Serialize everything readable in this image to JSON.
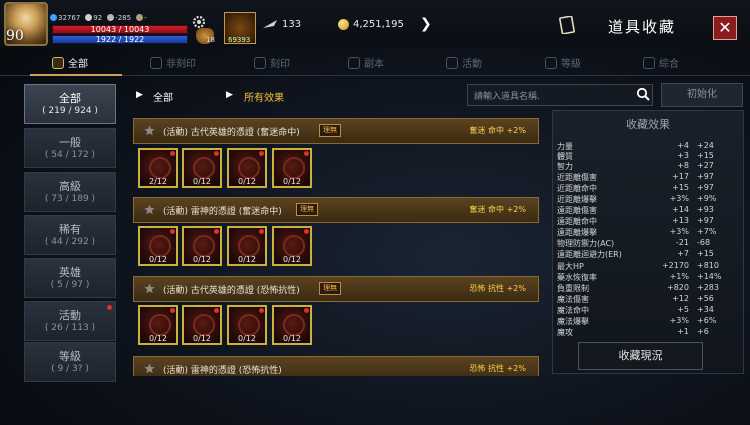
{
  "player": {
    "level": "90",
    "currency1": "32767",
    "stat2": "92",
    "stat3": "-285",
    "stat4": "-",
    "hp": "10043 / 10043",
    "mp": "1922 / 1922"
  },
  "topbar": {
    "pouch_count": "18",
    "quick_item_count": "69393",
    "wing_value": "133",
    "gold_value": "4,251,195",
    "title": "道具收藏"
  },
  "tabs": [
    {
      "label": "全部",
      "icon": "book-icon"
    },
    {
      "label": "非刻印",
      "icon": "no-seal-icon"
    },
    {
      "label": "刻印",
      "icon": "seal-icon"
    },
    {
      "label": "副本",
      "icon": "dungeon-icon"
    },
    {
      "label": "活動",
      "icon": "event-icon"
    },
    {
      "label": "等級",
      "icon": "level-icon"
    },
    {
      "label": "綜合",
      "icon": "combined-icon"
    }
  ],
  "sidebar": [
    {
      "name": "全部",
      "count": "( 219 / 924 )"
    },
    {
      "name": "一般",
      "count": "( 54 / 172 )"
    },
    {
      "name": "高級",
      "count": "( 73 / 189 )"
    },
    {
      "name": "稀有",
      "count": "( 44 / 292 )"
    },
    {
      "name": "英雄",
      "count": "( 5 / 97 )"
    },
    {
      "name": "活動",
      "count": "( 26 / 113 )"
    },
    {
      "name": "等級",
      "count": "( 9 / 3? )"
    }
  ],
  "filter": {
    "category": "全部",
    "effect": "所有效果",
    "search_placeholder": "請輸入道具名稱.",
    "reset_label": "初始化"
  },
  "collections": [
    {
      "name": "(活動) 古代英雄的憑證 (奮迷命中)",
      "tag": "理無",
      "effect": "奮迷 命中 +2%",
      "slots": [
        "2/12",
        "0/12",
        "0/12",
        "0/12"
      ]
    },
    {
      "name": "(活動) 雷神的憑證 (奮迷命中)",
      "tag": "理無",
      "effect": "奮迷 命中 +2%",
      "slots": [
        "0/12",
        "0/12",
        "0/12",
        "0/12"
      ]
    },
    {
      "name": "(活動) 古代英雄的憑證 (恐怖抗性)",
      "tag": "理無",
      "effect": "恐怖 抗性 +2%",
      "slots": [
        "0/12",
        "0/12",
        "0/12",
        "0/12"
      ]
    },
    {
      "name": "(活動) 雷神的憑證 (恐怖抗性)",
      "tag": "",
      "effect": "恐怖 抗性 +2%",
      "slots": []
    }
  ],
  "effects": {
    "title": "收藏效果",
    "rows": [
      {
        "name": "力量",
        "v1": "+4",
        "v2": "+24"
      },
      {
        "name": "體質",
        "v1": "+3",
        "v2": "+15"
      },
      {
        "name": "智力",
        "v1": "+8",
        "v2": "+27"
      },
      {
        "name": "近距離傷害",
        "v1": "+17",
        "v2": "+97"
      },
      {
        "name": "近距離命中",
        "v1": "+15",
        "v2": "+97"
      },
      {
        "name": "近距離爆擊",
        "v1": "+3%",
        "v2": "+9%"
      },
      {
        "name": "遠距離傷害",
        "v1": "+14",
        "v2": "+93"
      },
      {
        "name": "遠距離命中",
        "v1": "+13",
        "v2": "+97"
      },
      {
        "name": "遠距離爆擊",
        "v1": "+3%",
        "v2": "+7%"
      },
      {
        "name": "物理防禦力(AC)",
        "v1": "-21",
        "v2": "-68"
      },
      {
        "name": "遠距離迴避力(ER)",
        "v1": "+7",
        "v2": "+15"
      },
      {
        "name": "最大HP",
        "v1": "+2170",
        "v2": "+810"
      },
      {
        "name": "藥水恢復率",
        "v1": "+1%",
        "v2": "+14%"
      },
      {
        "name": "負重限制",
        "v1": "+820",
        "v2": "+283"
      },
      {
        "name": "魔法傷害",
        "v1": "+12",
        "v2": "+56"
      },
      {
        "name": "魔法命中",
        "v1": "+5",
        "v2": "+34"
      },
      {
        "name": "魔法爆擊",
        "v1": "+3%",
        "v2": "+6%"
      },
      {
        "name": "魔攻",
        "v1": "+1",
        "v2": "+6"
      }
    ],
    "status_button": "收藏現況"
  }
}
